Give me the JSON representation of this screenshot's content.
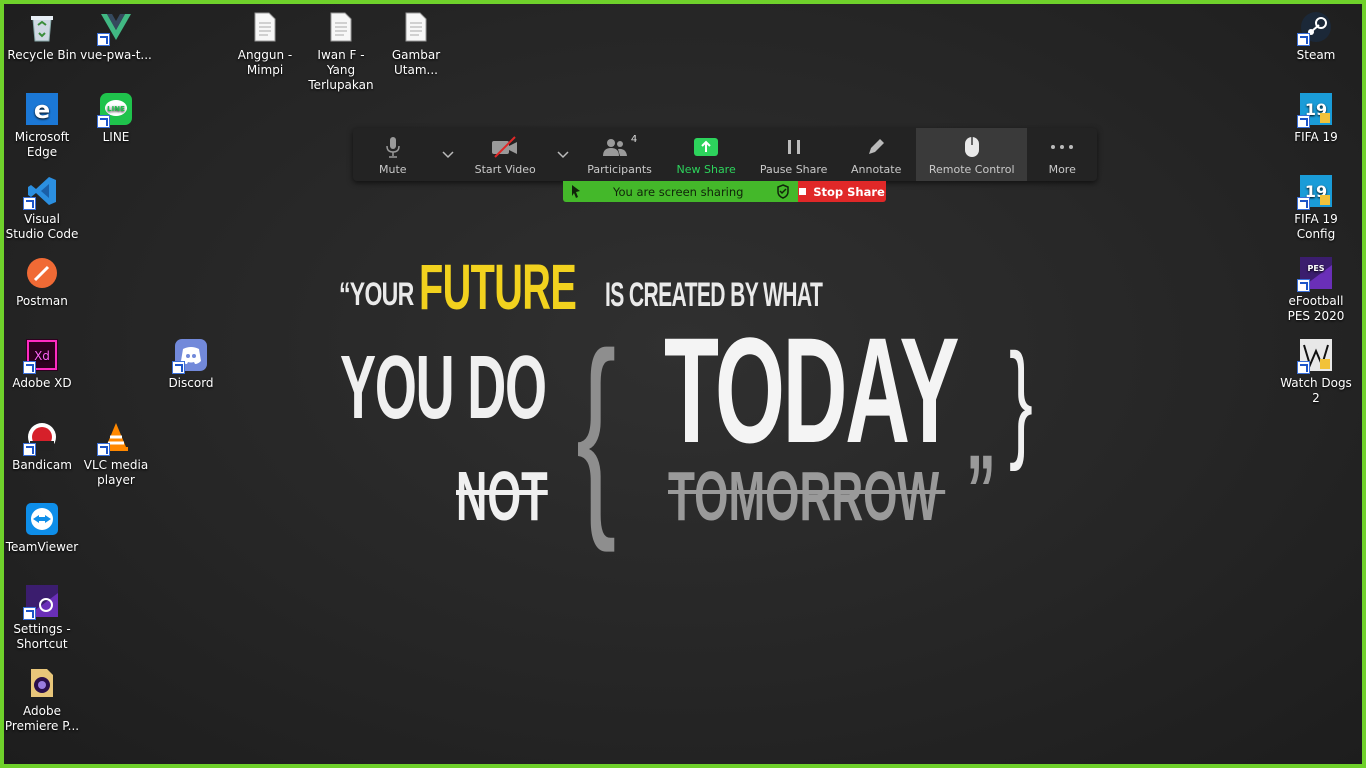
{
  "desktop": {
    "left_icons": [
      {
        "label": "Recycle Bin",
        "icon": "recycle-bin-icon"
      },
      {
        "label": "vue-pwa-t...",
        "icon": "vue-icon"
      },
      {
        "label": "Anggun - Mimpi",
        "icon": "document-icon"
      },
      {
        "label": "Iwan F - Yang Terlupakan",
        "icon": "document-icon"
      },
      {
        "label": "Gambar Utam...",
        "icon": "document-icon"
      },
      {
        "label": "Microsoft Edge",
        "icon": "edge-icon"
      },
      {
        "label": "LINE",
        "icon": "line-icon"
      },
      {
        "label": "Visual Studio Code",
        "icon": "vscode-icon"
      },
      {
        "label": "Postman",
        "icon": "postman-icon"
      },
      {
        "label": "Adobe XD",
        "icon": "adobe-xd-icon"
      },
      {
        "label": "Discord",
        "icon": "discord-icon"
      },
      {
        "label": "Bandicam",
        "icon": "bandicam-icon"
      },
      {
        "label": "VLC media player",
        "icon": "vlc-icon"
      },
      {
        "label": "TeamViewer",
        "icon": "teamviewer-icon"
      },
      {
        "label": "Settings - Shortcut",
        "icon": "pes-settings-icon"
      },
      {
        "label": "Adobe Premiere P...",
        "icon": "premiere-icon"
      }
    ],
    "right_icons": [
      {
        "label": "Steam",
        "icon": "steam-icon"
      },
      {
        "label": "FIFA 19",
        "icon": "fifa-icon"
      },
      {
        "label": "FIFA 19 Config",
        "icon": "fifa-config-icon"
      },
      {
        "label": "eFootball PES 2020",
        "icon": "pes-icon"
      },
      {
        "label": "Watch Dogs 2",
        "icon": "watch-dogs-icon"
      }
    ]
  },
  "toolbar": {
    "mute": "Mute",
    "start_video": "Start Video",
    "participants": "Participants",
    "participants_count": "4",
    "new_share": "New Share",
    "pause_share": "Pause Share",
    "annotate": "Annotate",
    "remote_control": "Remote Control",
    "more": "More"
  },
  "share_bar": {
    "status": "You are screen sharing",
    "stop": "Stop Share"
  },
  "wallpaper": {
    "line1_a": "“YOUR",
    "line1_b": "FUTURE",
    "line1_c": "IS CREATED BY WHAT",
    "line2": "YOU DO",
    "brace_open": "{",
    "today": "TODAY",
    "brace_close": "}",
    "not": "NOT",
    "tomorrow": "TOMORROW",
    "end_quote": "”"
  },
  "colors": {
    "frame_border": "#6fd12b",
    "highlight_yellow": "#f2d21e",
    "sharing_green": "#44b82a",
    "stop_red": "#e02828"
  }
}
